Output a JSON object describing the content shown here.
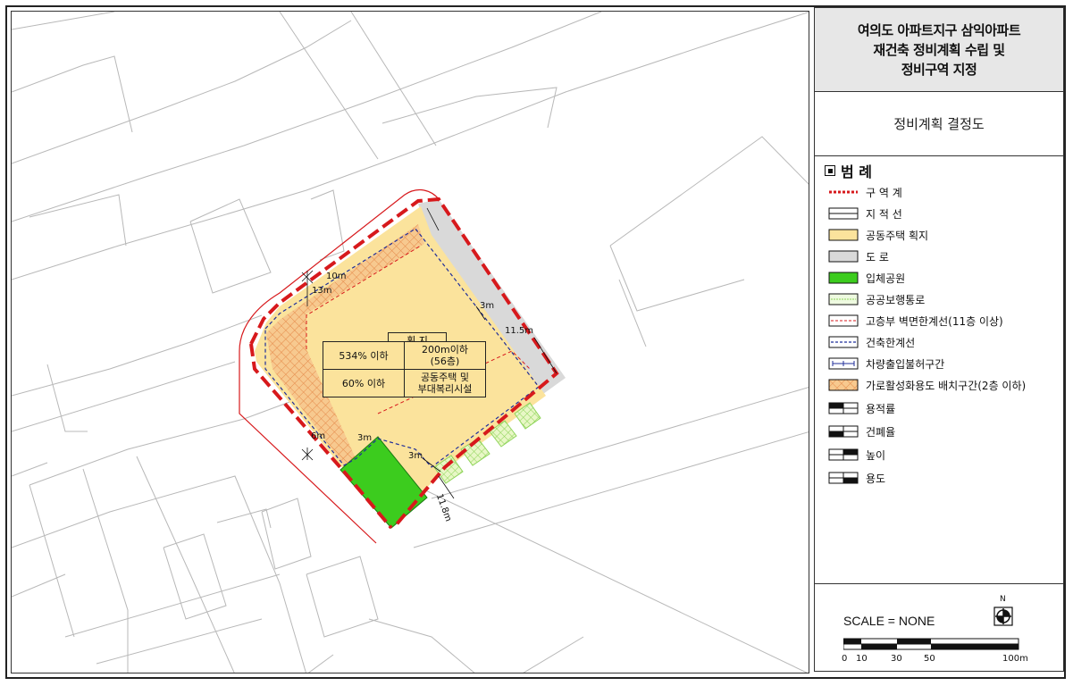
{
  "title": {
    "line1": "여의도 아파트지구 삼익아파트",
    "line2": "재건축 정비계획 수립 및",
    "line3": "정비구역 지정"
  },
  "subtitle": "정비계획 결정도",
  "legend": {
    "heading": "범 례",
    "items": [
      {
        "label": "구 역 계",
        "icon": "district-boundary"
      },
      {
        "label": "지 적 선",
        "icon": "cadastral-line"
      },
      {
        "label": "공동주택 획지",
        "icon": "apartment-lot",
        "color": "#fbe39c"
      },
      {
        "label": "도 로",
        "icon": "road",
        "color": "#d9d9d9"
      },
      {
        "label": "입체공원",
        "icon": "three-dimensional-park",
        "color": "#3ccc1e"
      },
      {
        "label": "공공보행통로",
        "icon": "public-pedestrian-path"
      },
      {
        "label": "고층부 벽면한계선(11층 이상)",
        "icon": "upper-wall-limit-line"
      },
      {
        "label": "건축한계선",
        "icon": "building-limit-line"
      },
      {
        "label": "차량출입불허구간",
        "icon": "no-vehicle-entry-zone"
      },
      {
        "label": "가로활성화용도 배치구간(2층 이하)",
        "icon": "street-activation-zone"
      },
      {
        "label": "용적률",
        "icon": "floor-area-ratio"
      },
      {
        "label": "건폐율",
        "icon": "building-coverage-ratio"
      },
      {
        "label": "높이",
        "icon": "height"
      },
      {
        "label": "용도",
        "icon": "use"
      }
    ]
  },
  "map": {
    "lot_label": "획 지",
    "floor_area_ratio": "534% 이하",
    "height_line1": "200m이하",
    "height_line2": "(56층)",
    "coverage_ratio": "60% 이하",
    "use_line1": "공동주택 및",
    "use_line2": "부대복리시설",
    "dimensions": {
      "d10": "10m",
      "d13": "13m",
      "d3_a": "3m",
      "d11_5": "11.5m",
      "d6": "6m",
      "d3_b": "3m",
      "d3_c": "3m",
      "d11_8": "11.8m"
    },
    "colors": {
      "lot": "#fbe39c",
      "park": "#3ccc1e",
      "road": "#d9d9d9",
      "boundary": "#d7191c",
      "building_limit": "#1f2e9a",
      "street_activation": "#f2a56a"
    }
  },
  "scale": {
    "text": "SCALE = NONE",
    "north": "N",
    "ticks": [
      "0",
      "10",
      "30",
      "50",
      "100m"
    ]
  }
}
